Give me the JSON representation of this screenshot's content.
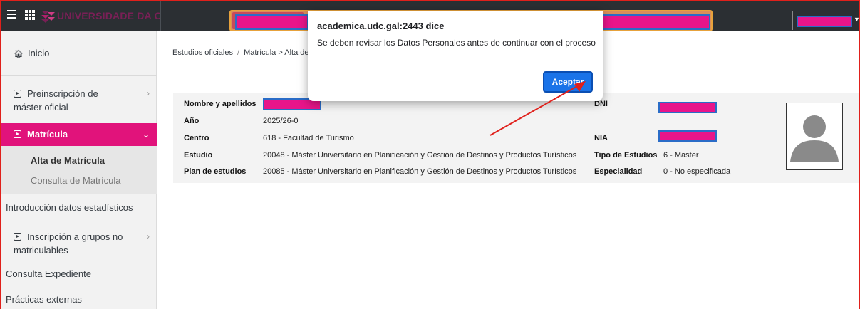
{
  "topbar": {
    "university_name": "UNIVERSIDADE DA COR",
    "brand_color": "#7a1f56"
  },
  "sidebar": {
    "items": [
      {
        "label": "Inicio",
        "icon": "home-icon"
      },
      {
        "label": "Preinscripción de máster oficial",
        "icon": "play-square-icon"
      },
      {
        "label": "Matrícula",
        "icon": "play-square-icon"
      },
      {
        "label": "Alta de Matrícula"
      },
      {
        "label": "Consulta de Matrícula"
      },
      {
        "label": "Introducción datos estadísticos"
      },
      {
        "label": "Inscripción a grupos no matriculables",
        "icon": "play-square-icon"
      },
      {
        "label": "Consulta Expediente"
      },
      {
        "label": "Prácticas externas"
      }
    ],
    "active_color": "#e1137b"
  },
  "breadcrumb": {
    "items": [
      "Estudios oficiales",
      "Matrícula > Alta de M"
    ],
    "separator": "/"
  },
  "student": {
    "name_label": "Nombre y apellidos",
    "year_label": "Año",
    "year_value": "2025/26-0",
    "center_label": "Centro",
    "center_value": "618 - Facultad de Turismo",
    "study_label": "Estudio",
    "study_value": "20048 - Máster Universitario en Planificación y Gestión de Destinos y Productos Turísticos",
    "plan_label": "Plan de estudios",
    "plan_value": "20085 - Máster Universitario en Planificación y Gestión de Destinos y Productos Turísticos",
    "dni_label": "DNI",
    "nia_label": "NIA",
    "type_label": "Tipo de Estudios",
    "type_value": "6 - Master",
    "specialty_label": "Especialidad",
    "specialty_value": "0 - No especificada"
  },
  "dialog": {
    "title": "academica.udc.gal:2443 dice",
    "message": "Se deben revisar los Datos Personales antes de continuar con el proceso",
    "button_label": "Aceptar"
  },
  "colors": {
    "redaction": "#e8158a",
    "annotation_arrow": "#e0201b",
    "dialog_button": "#1a73e8"
  }
}
